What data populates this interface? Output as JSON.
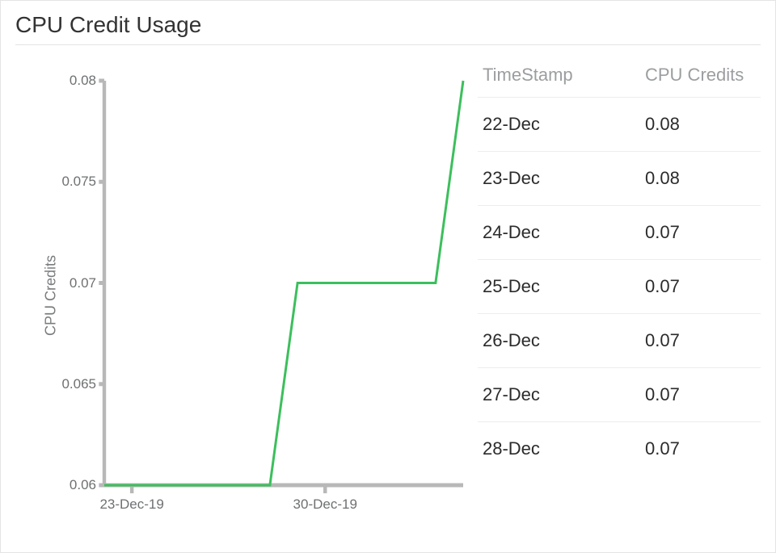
{
  "title": "CPU Credit Usage",
  "chart_data": {
    "type": "line",
    "title": "CPU Credit Usage",
    "ylabel": "CPU Credits",
    "xlabel": "",
    "ylim": [
      0.06,
      0.08
    ],
    "yticks": [
      0.06,
      0.065,
      0.07,
      0.075,
      0.08
    ],
    "xticks_visible": [
      "23-Dec-19",
      "30-Dec-19"
    ],
    "x": [
      "22-Dec-19",
      "23-Dec-19",
      "24-Dec-19",
      "25-Dec-19",
      "26-Dec-19",
      "27-Dec-19",
      "28-Dec-19",
      "29-Dec-19",
      "30-Dec-19",
      "31-Dec-19",
      "01-Jan-20",
      "02-Jan-20",
      "03-Jan-20",
      "04-Jan-20"
    ],
    "series": [
      {
        "name": "CPU Credits",
        "color": "#3cbf5c",
        "values": [
          0.06,
          0.06,
          0.06,
          0.06,
          0.06,
          0.06,
          0.06,
          0.07,
          0.07,
          0.07,
          0.07,
          0.07,
          0.07,
          0.08
        ]
      }
    ]
  },
  "table": {
    "headers": {
      "timestamp": "TimeStamp",
      "cpu": "CPU Credits"
    },
    "rows": [
      {
        "ts": "22-Dec",
        "cpu": "0.08"
      },
      {
        "ts": "23-Dec",
        "cpu": "0.08"
      },
      {
        "ts": "24-Dec",
        "cpu": "0.07"
      },
      {
        "ts": "25-Dec",
        "cpu": "0.07"
      },
      {
        "ts": "26-Dec",
        "cpu": "0.07"
      },
      {
        "ts": "27-Dec",
        "cpu": "0.07"
      },
      {
        "ts": "28-Dec",
        "cpu": "0.07"
      }
    ]
  }
}
